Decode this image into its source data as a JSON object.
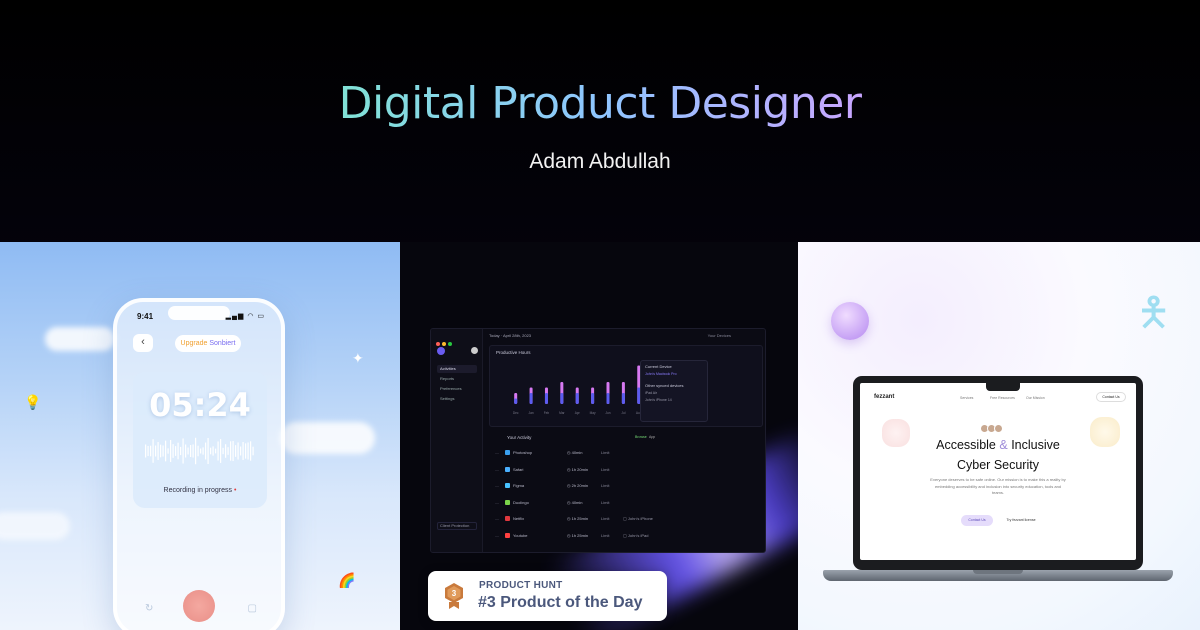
{
  "hero": {
    "title": "Digital Product Designer",
    "subtitle": "Adam Abdullah"
  },
  "phone_panel": {
    "status_time": "9:41",
    "status_icons": "▂▄▆ ◠ ▭",
    "back_icon": "chevron-left-icon",
    "upgrade": {
      "word1": "Upgrade",
      "word2": "Sonbiert"
    },
    "timer": "05:24",
    "recording_label": "Recording in progress",
    "recording_dot": "•",
    "bottom_left_icon": "↻",
    "bottom_right_icon": "▢",
    "emoji_bulb": "💡",
    "emoji_rainbow": "🌈"
  },
  "dashboard_panel": {
    "header_date": "Today · April 28th, 2023",
    "header_right": "Your Devices",
    "nav": [
      "Activities",
      "Reports",
      "Preferences",
      "Settings"
    ],
    "sidebar_bottom": "Client Protection",
    "chart_title": "Productive Hours",
    "chart_data": {
      "type": "bar",
      "title": "Productive Hours",
      "categories": [
        "Dec",
        "Jan",
        "Feb",
        "Mar",
        "Apr",
        "May",
        "Jun",
        "Jul",
        "Aug",
        "Sep",
        "Oct",
        "Nov",
        "Dec"
      ],
      "series": [
        {
          "values": [
            2,
            3,
            3,
            4,
            3,
            3,
            4,
            4,
            7,
            3,
            3,
            3,
            4
          ]
        },
        {
          "values": [
            1,
            2,
            2,
            2,
            2,
            2,
            2,
            2,
            3,
            2,
            2,
            2,
            2
          ]
        }
      ]
    },
    "device_popover": {
      "title": "Current Device",
      "current": "John's Macbook Pro",
      "others_title": "Other synced devices",
      "others": [
        "iPad Air",
        "John's iPhone 14"
      ]
    },
    "activity_title": "Your Activity",
    "activity_toggle": [
      "Browse",
      "App"
    ],
    "activity_rows": [
      {
        "name": "Photoshop",
        "time": "40min",
        "limit": "Limit",
        "device": "",
        "color": "#3aa0f0"
      },
      {
        "name": "Safari",
        "time": "1h 20min",
        "limit": "Limit",
        "device": "",
        "color": "#4ab0ff"
      },
      {
        "name": "Figma",
        "time": "2h 20min",
        "limit": "Limit",
        "device": "",
        "color": "#47c2ff"
      },
      {
        "name": "Duolingo",
        "time": "40min",
        "limit": "Limit",
        "device": "",
        "color": "#7bd34a"
      },
      {
        "name": "Netflix",
        "time": "1h 25min",
        "limit": "Limit",
        "device": "John's iPhone",
        "color": "#e0383e"
      },
      {
        "name": "Youtube",
        "time": "1h 25min",
        "limit": "Limit",
        "device": "John's iPad",
        "color": "#ff4040"
      }
    ],
    "badge": {
      "kicker": "PRODUCT HUNT",
      "rank": "#3 Product of the Day",
      "medal_number": "3"
    }
  },
  "laptop_panel": {
    "site_logo": "fezzant",
    "site_nav": [
      "Services",
      "Free Resources",
      "Our Mission"
    ],
    "site_cta": "Contact Us",
    "headline_1": "Accessible",
    "headline_amp": "&",
    "headline_2": "Inclusive",
    "headline_3": "Cyber Security",
    "body": "Everyone deserves to be safe online. Our mission is to make this a reality by embedding accessibility and inclusion into security education, tools and teams.",
    "button_primary": "Contact Us",
    "button_secondary": "Try fezzant license"
  },
  "colors": {
    "accent_purple": "#7a6ef0",
    "bar_blue": "#5b5cf0",
    "bar_pink": "#d779f2",
    "badge_text": "#4b587c",
    "medal": "#c97a3c"
  }
}
